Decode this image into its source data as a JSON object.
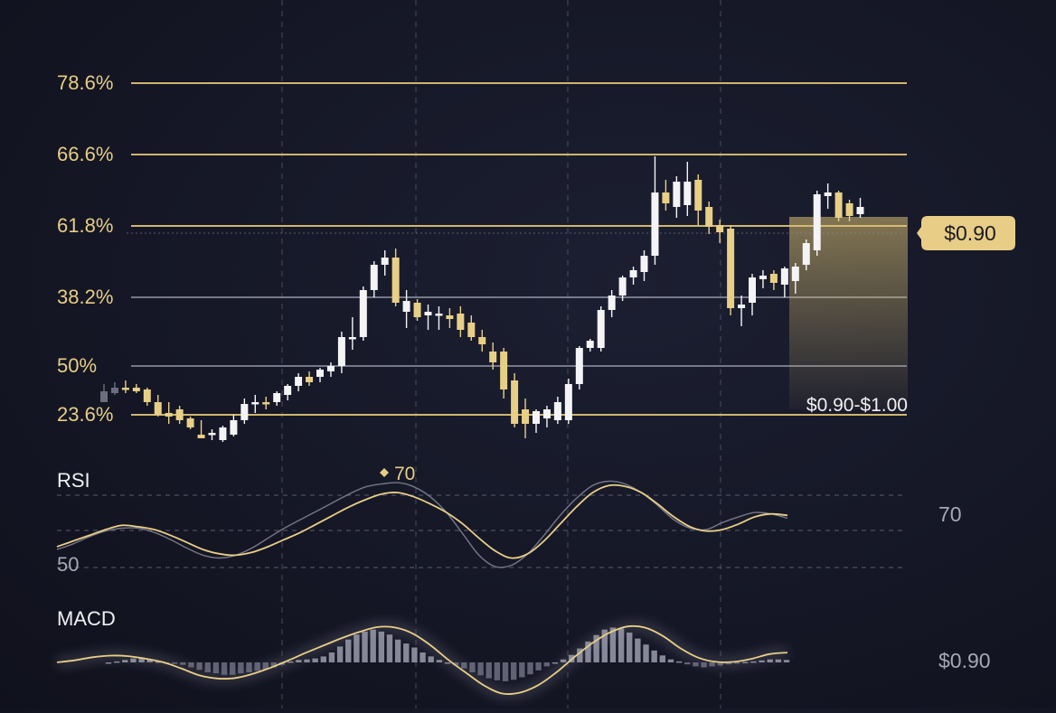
{
  "colors": {
    "background": "#161827",
    "gold": "#e8cf86",
    "gold_line": "#d9bf72",
    "white_candle": "#f4f4f6",
    "gray_line": "#8e8fa0",
    "grid": "#5a5d70",
    "text_gold": "#e6cd86",
    "text_white": "#f0f0f2",
    "text_muted": "#a7a8b6"
  },
  "chart_data": [
    {
      "type": "candlestick",
      "title": "",
      "fib_levels": [
        {
          "label": "78.6%",
          "style": "gold"
        },
        {
          "label": "66.6%",
          "style": "gold"
        },
        {
          "label": "61.8%",
          "style": "gold"
        },
        {
          "label": "38.2%",
          "style": "gray"
        },
        {
          "label": "50%",
          "style": "gray"
        },
        {
          "label": "23.6%",
          "style": "gold"
        }
      ],
      "price_tag": "$0.90",
      "zone_label": "$0.90-$1.00",
      "grid": true,
      "candles": [
        {
          "o": 0.28,
          "h": 0.32,
          "l": 0.22,
          "c": 0.22,
          "dir": "faded"
        },
        {
          "o": 0.27,
          "h": 0.33,
          "l": 0.26,
          "c": 0.3,
          "dir": "faded"
        },
        {
          "o": 0.3,
          "h": 0.34,
          "l": 0.27,
          "c": 0.3,
          "dir": "down"
        },
        {
          "o": 0.3,
          "h": 0.32,
          "l": 0.27,
          "c": 0.28,
          "dir": "down"
        },
        {
          "o": 0.29,
          "h": 0.3,
          "l": 0.2,
          "c": 0.22,
          "dir": "down"
        },
        {
          "o": 0.22,
          "h": 0.26,
          "l": 0.14,
          "c": 0.15,
          "dir": "down"
        },
        {
          "o": 0.16,
          "h": 0.22,
          "l": 0.1,
          "c": 0.14,
          "dir": "down"
        },
        {
          "o": 0.18,
          "h": 0.2,
          "l": 0.1,
          "c": 0.12,
          "dir": "down"
        },
        {
          "o": 0.13,
          "h": 0.14,
          "l": 0.07,
          "c": 0.08,
          "dir": "down"
        },
        {
          "o": 0.04,
          "h": 0.12,
          "l": 0.02,
          "c": 0.02,
          "dir": "down"
        },
        {
          "o": 0.04,
          "h": 0.07,
          "l": 0.01,
          "c": 0.05,
          "dir": "up"
        },
        {
          "o": 0.01,
          "h": 0.09,
          "l": 0.0,
          "c": 0.08,
          "dir": "up"
        },
        {
          "o": 0.04,
          "h": 0.15,
          "l": 0.03,
          "c": 0.12,
          "dir": "up"
        },
        {
          "o": 0.12,
          "h": 0.24,
          "l": 0.1,
          "c": 0.21,
          "dir": "up"
        },
        {
          "o": 0.21,
          "h": 0.26,
          "l": 0.16,
          "c": 0.22,
          "dir": "up"
        },
        {
          "o": 0.22,
          "h": 0.25,
          "l": 0.18,
          "c": 0.21,
          "dir": "down"
        },
        {
          "o": 0.22,
          "h": 0.28,
          "l": 0.2,
          "c": 0.27,
          "dir": "up"
        },
        {
          "o": 0.26,
          "h": 0.32,
          "l": 0.23,
          "c": 0.31,
          "dir": "up"
        },
        {
          "o": 0.31,
          "h": 0.38,
          "l": 0.28,
          "c": 0.36,
          "dir": "up"
        },
        {
          "o": 0.36,
          "h": 0.39,
          "l": 0.31,
          "c": 0.33,
          "dir": "down"
        },
        {
          "o": 0.36,
          "h": 0.41,
          "l": 0.33,
          "c": 0.4,
          "dir": "up"
        },
        {
          "o": 0.39,
          "h": 0.44,
          "l": 0.36,
          "c": 0.42,
          "dir": "up"
        },
        {
          "o": 0.42,
          "h": 0.61,
          "l": 0.38,
          "c": 0.58,
          "dir": "up"
        },
        {
          "o": 0.58,
          "h": 0.69,
          "l": 0.51,
          "c": 0.58,
          "dir": "up"
        },
        {
          "o": 0.58,
          "h": 0.86,
          "l": 0.56,
          "c": 0.84,
          "dir": "up"
        },
        {
          "o": 0.84,
          "h": 1.0,
          "l": 0.8,
          "c": 0.98,
          "dir": "up"
        },
        {
          "o": 0.98,
          "h": 1.06,
          "l": 0.92,
          "c": 1.02,
          "dir": "up"
        },
        {
          "o": 1.02,
          "h": 1.07,
          "l": 0.75,
          "c": 0.77,
          "dir": "down"
        },
        {
          "o": 0.78,
          "h": 0.84,
          "l": 0.63,
          "c": 0.72,
          "dir": "up"
        },
        {
          "o": 0.77,
          "h": 0.79,
          "l": 0.67,
          "c": 0.69,
          "dir": "down"
        },
        {
          "o": 0.72,
          "h": 0.76,
          "l": 0.62,
          "c": 0.7,
          "dir": "up"
        },
        {
          "o": 0.71,
          "h": 0.75,
          "l": 0.62,
          "c": 0.7,
          "dir": "up"
        },
        {
          "o": 0.7,
          "h": 0.74,
          "l": 0.63,
          "c": 0.68,
          "dir": "down"
        },
        {
          "o": 0.71,
          "h": 0.75,
          "l": 0.58,
          "c": 0.62,
          "dir": "down"
        },
        {
          "o": 0.66,
          "h": 0.7,
          "l": 0.56,
          "c": 0.58,
          "dir": "down"
        },
        {
          "o": 0.58,
          "h": 0.62,
          "l": 0.5,
          "c": 0.54,
          "dir": "down"
        },
        {
          "o": 0.5,
          "h": 0.55,
          "l": 0.4,
          "c": 0.44,
          "dir": "down"
        },
        {
          "o": 0.5,
          "h": 0.52,
          "l": 0.24,
          "c": 0.29,
          "dir": "down"
        },
        {
          "o": 0.34,
          "h": 0.38,
          "l": 0.08,
          "c": 0.1,
          "dir": "down"
        },
        {
          "o": 0.18,
          "h": 0.24,
          "l": 0.02,
          "c": 0.1,
          "dir": "down"
        },
        {
          "o": 0.1,
          "h": 0.18,
          "l": 0.05,
          "c": 0.17,
          "dir": "up"
        },
        {
          "o": 0.13,
          "h": 0.2,
          "l": 0.08,
          "c": 0.18,
          "dir": "up"
        },
        {
          "o": 0.12,
          "h": 0.25,
          "l": 0.1,
          "c": 0.22,
          "dir": "up"
        },
        {
          "o": 0.12,
          "h": 0.35,
          "l": 0.1,
          "c": 0.32,
          "dir": "up"
        },
        {
          "o": 0.32,
          "h": 0.53,
          "l": 0.29,
          "c": 0.52,
          "dir": "up"
        },
        {
          "o": 0.52,
          "h": 0.57,
          "l": 0.5,
          "c": 0.56,
          "dir": "up"
        },
        {
          "o": 0.52,
          "h": 0.75,
          "l": 0.5,
          "c": 0.73,
          "dir": "up"
        },
        {
          "o": 0.73,
          "h": 0.84,
          "l": 0.69,
          "c": 0.81,
          "dir": "up"
        },
        {
          "o": 0.81,
          "h": 0.92,
          "l": 0.78,
          "c": 0.91,
          "dir": "up"
        },
        {
          "o": 0.91,
          "h": 0.97,
          "l": 0.87,
          "c": 0.95,
          "dir": "up"
        },
        {
          "o": 0.94,
          "h": 1.06,
          "l": 0.89,
          "c": 1.03,
          "dir": "up"
        },
        {
          "o": 1.03,
          "h": 1.58,
          "l": 0.98,
          "c": 1.38,
          "dir": "up"
        },
        {
          "o": 1.38,
          "h": 1.45,
          "l": 1.28,
          "c": 1.32,
          "dir": "down"
        },
        {
          "o": 1.3,
          "h": 1.47,
          "l": 1.24,
          "c": 1.44,
          "dir": "up"
        },
        {
          "o": 1.31,
          "h": 1.55,
          "l": 1.25,
          "c": 1.44,
          "dir": "up"
        },
        {
          "o": 1.45,
          "h": 1.48,
          "l": 1.2,
          "c": 1.28,
          "dir": "down"
        },
        {
          "o": 1.3,
          "h": 1.33,
          "l": 1.15,
          "c": 1.19,
          "dir": "down"
        },
        {
          "o": 1.2,
          "h": 1.23,
          "l": 1.1,
          "c": 1.16,
          "dir": "down"
        },
        {
          "o": 1.18,
          "h": 1.2,
          "l": 0.7,
          "c": 0.74,
          "dir": "down"
        },
        {
          "o": 0.74,
          "h": 0.81,
          "l": 0.64,
          "c": 0.76,
          "dir": "up"
        },
        {
          "o": 0.77,
          "h": 0.93,
          "l": 0.7,
          "c": 0.91,
          "dir": "up"
        },
        {
          "o": 0.9,
          "h": 0.95,
          "l": 0.85,
          "c": 0.92,
          "dir": "up"
        },
        {
          "o": 0.93,
          "h": 0.95,
          "l": 0.84,
          "c": 0.88,
          "dir": "down"
        },
        {
          "o": 0.87,
          "h": 0.97,
          "l": 0.8,
          "c": 0.96,
          "dir": "up"
        },
        {
          "o": 0.89,
          "h": 0.99,
          "l": 0.82,
          "c": 0.97,
          "dir": "up"
        },
        {
          "o": 0.98,
          "h": 1.12,
          "l": 0.95,
          "c": 1.1,
          "dir": "up"
        },
        {
          "o": 1.06,
          "h": 1.39,
          "l": 1.03,
          "c": 1.37,
          "dir": "up"
        },
        {
          "o": 1.36,
          "h": 1.43,
          "l": 1.29,
          "c": 1.38,
          "dir": "up"
        },
        {
          "o": 1.38,
          "h": 1.39,
          "l": 1.22,
          "c": 1.24,
          "dir": "down"
        },
        {
          "o": 1.32,
          "h": 1.34,
          "l": 1.22,
          "c": 1.25,
          "dir": "down"
        },
        {
          "o": 1.26,
          "h": 1.35,
          "l": 1.24,
          "c": 1.3,
          "dir": "up"
        }
      ]
    },
    {
      "type": "line",
      "title": "RSI",
      "marker_label": "70",
      "right_label": "70",
      "left_label": "50",
      "series": [
        {
          "style": "gold",
          "values": [
            47,
            49,
            51,
            53,
            54.5,
            54,
            53,
            51,
            48.5,
            46,
            44.5,
            44,
            45,
            47,
            49.5,
            52,
            55,
            58,
            61,
            63.5,
            65.5,
            66,
            64.5,
            62,
            59,
            55,
            50,
            45.5,
            43,
            44.5,
            49,
            55,
            61,
            66,
            68.5,
            68.2,
            66,
            62,
            57.5,
            54,
            52.5,
            53,
            55,
            57.5,
            58.5,
            58
          ]
        },
        {
          "style": "gray",
          "values": [
            46,
            48,
            50.5,
            52.5,
            53.5,
            53.5,
            52,
            49.5,
            46.5,
            44,
            43,
            44,
            46.5,
            50,
            53.5,
            56.5,
            59.5,
            62.5,
            65.5,
            68,
            69,
            69.5,
            68,
            64.5,
            59,
            51.5,
            44,
            40,
            40.5,
            44.5,
            51,
            58,
            64,
            68.5,
            70,
            69,
            66,
            61.5,
            56.5,
            53.5,
            53,
            55.5,
            57.5,
            59,
            58.5,
            57
          ]
        }
      ]
    },
    {
      "type": "line",
      "title": "MACD",
      "right_label": "$0.90",
      "series": [
        {
          "style": "gold",
          "values": [
            0,
            0.2,
            0.5,
            0.65,
            0.6,
            0.35,
            0,
            -0.6,
            -1.25,
            -1.55,
            -1.5,
            -1.1,
            -0.5,
            0.2,
            0.95,
            1.65,
            2.35,
            2.95,
            3.4,
            3.35,
            2.75,
            1.6,
            0.2,
            -1.05,
            -2.25,
            -3.0,
            -2.9,
            -2.2,
            -1.0,
            0.45,
            1.8,
            2.85,
            3.45,
            3.35,
            2.55,
            1.35,
            0.45,
            0.05,
            0.05,
            0.35,
            0.8,
            0.95
          ]
        }
      ],
      "histogram": [
        0,
        0.02,
        0.05,
        0.08,
        0.1,
        0.06,
        0.02,
        -0.02,
        -0.03,
        -0.05,
        -0.1,
        -0.15,
        -0.2,
        -0.22,
        -0.25,
        -0.25,
        -0.22,
        -0.2,
        -0.17,
        -0.14,
        -0.1,
        -0.05,
        0.02,
        0.05,
        0.06,
        0.08,
        0.12,
        0.2,
        0.32,
        0.46,
        0.56,
        0.62,
        0.66,
        0.62,
        0.56,
        0.46,
        0.38,
        0.3,
        0.2,
        0.12,
        0.05,
        0.0,
        -0.06,
        -0.12,
        -0.2,
        -0.26,
        -0.32,
        -0.36,
        -0.38,
        -0.35,
        -0.3,
        -0.24,
        -0.16,
        -0.08,
        0.0,
        0.06,
        0.15,
        0.28,
        0.42,
        0.55,
        0.66,
        0.7,
        0.68,
        0.6,
        0.48,
        0.36,
        0.24,
        0.14,
        0.06,
        0.02,
        -0.04,
        -0.08,
        -0.1,
        -0.08,
        -0.06,
        -0.04,
        -0.02,
        0.01,
        0.02,
        0.04,
        0.06,
        0.06,
        0.05
      ]
    }
  ]
}
